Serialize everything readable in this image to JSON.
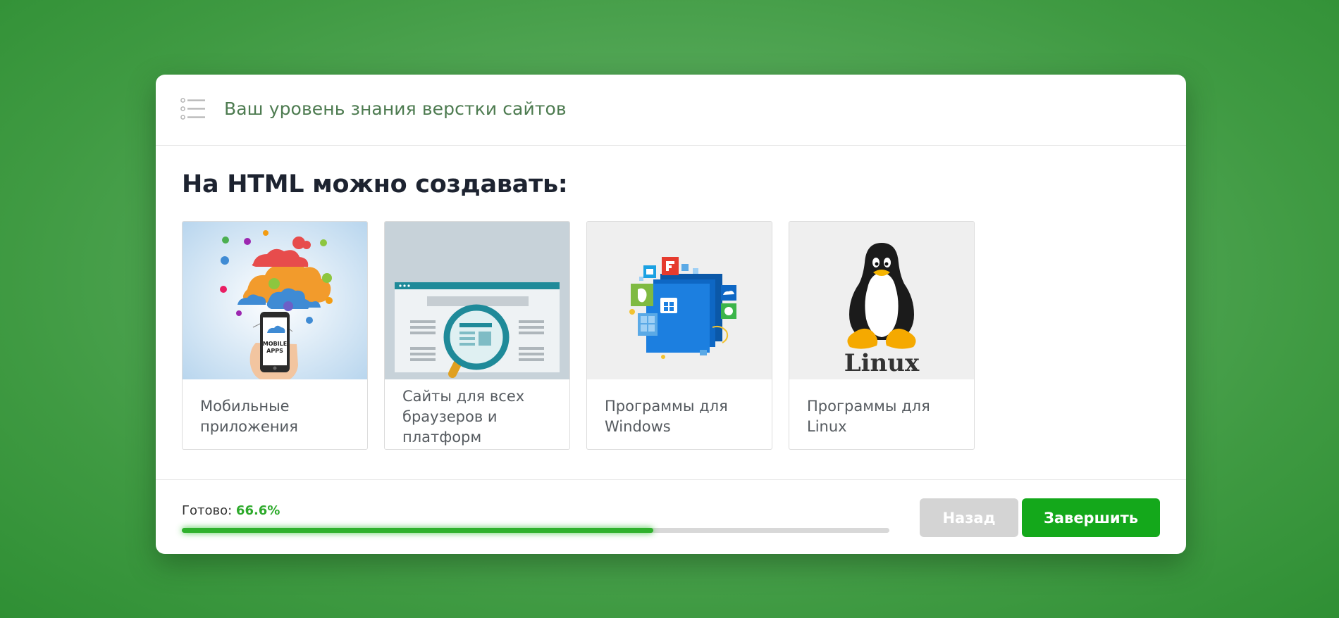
{
  "header": {
    "title": "Ваш уровень знания верстки сайтов",
    "icon": "list-icon"
  },
  "question": "На HTML можно создавать:",
  "options": [
    {
      "label": "Мобильные приложения",
      "image_text": "MOBILE APPS"
    },
    {
      "label": "Сайты для всех браузеров и платформ"
    },
    {
      "label": "Программы для Windows"
    },
    {
      "label": "Программы для Linux",
      "image_text": "Linux"
    }
  ],
  "progress": {
    "label": "Готово:",
    "value_text": "66.6%",
    "value": 0.666
  },
  "buttons": {
    "back": "Назад",
    "finish": "Завершить"
  },
  "colors": {
    "accent": "#14a81b",
    "progress": "#2fb12c",
    "header_text": "#4d7b50",
    "background": "#4fa552"
  }
}
